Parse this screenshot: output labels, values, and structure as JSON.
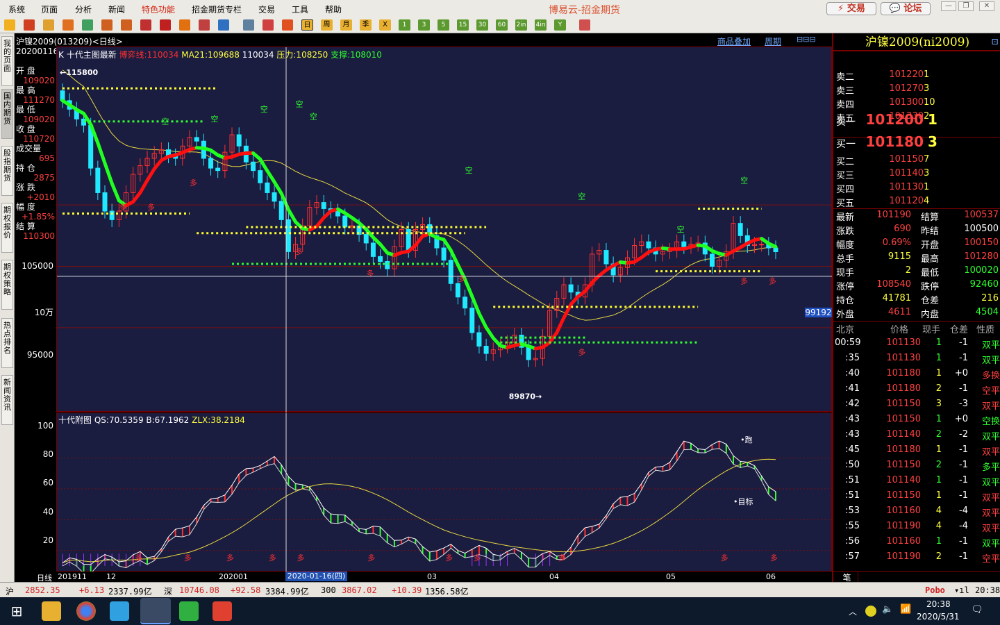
{
  "app": {
    "title": "博易云-招金期货"
  },
  "menu": [
    "系统",
    "页面",
    "分析",
    "新闻",
    "特色功能",
    "招金期货专栏",
    "交易",
    "工具",
    "帮助"
  ],
  "top_buttons": {
    "trade": "交易",
    "forum": "论坛"
  },
  "toolbar": {
    "period_labels": [
      "日",
      "周",
      "月",
      "季",
      "X",
      "1",
      "3",
      "5",
      "15",
      "30",
      "60",
      "2in",
      "4in",
      "Y"
    ]
  },
  "left_tabs": [
    "我的页面",
    "国内期货",
    "股指期货",
    "期权报价",
    "期权策略",
    "热点排名",
    "新闻资讯"
  ],
  "chart": {
    "title": "沪镍2009(013209)<日线>",
    "header_links": [
      "商品叠加",
      "周期"
    ],
    "main_legend": {
      "k": "K",
      "name": "十代主图最新",
      "bo": "博弈线:110034",
      "ma": "MA21:109688",
      "v3": "110034",
      "press": "压力:108250",
      "support": "支撑:108010"
    },
    "sub_legend": {
      "name": "十代附图",
      "qs": "QS:70.5359",
      "b": "B:67.1962",
      "zlx": "ZLX:38.2184"
    },
    "info_col": [
      {
        "label": "20200116",
        "value": ""
      },
      {
        "label": "开 盘",
        "value": "109020"
      },
      {
        "label": "最 高",
        "value": "111270"
      },
      {
        "label": "最 低",
        "value": "109020"
      },
      {
        "label": "收 盘",
        "value": "110720"
      },
      {
        "label": "成交量",
        "value": "695"
      },
      {
        "label": "持 仓",
        "value": "2875"
      },
      {
        "label": "涨 跌",
        "value": "+2010"
      },
      {
        "label": "幅 度",
        "value": "+1.85%"
      },
      {
        "label": "结 算",
        "value": "110300"
      }
    ],
    "main_yaxis": [
      "105000",
      "10万",
      "95000"
    ],
    "sub_yaxis": [
      "100",
      "80",
      "60",
      "40",
      "20"
    ],
    "annotations": {
      "high": "←115800",
      "low": "89870→",
      "pao": "•跑",
      "target": "•目标",
      "kong": "空",
      "duo": "多"
    },
    "price_tag": "99192",
    "xaxis": {
      "period": "日线",
      "labels": [
        "201911",
        "12",
        "202001",
        "03",
        "04",
        "05",
        "06"
      ],
      "cursor_date": "2020-01-16(四)"
    },
    "colors": {
      "up": "#ff3030",
      "down": "#20e8ff",
      "trend_up": "#ff1010",
      "trend_down": "#20ff20",
      "ma": "#e8d840",
      "resist": "#ffff30",
      "support": "#30ff30"
    }
  },
  "chart_data": {
    "type": "candlestick",
    "title": "沪镍2009(013209)<日线>",
    "x_range": [
      "2019-11",
      "2020-06"
    ],
    "ylim": [
      89000,
      117000
    ],
    "marked_high": 115800,
    "marked_low": 89870,
    "close_approx": [
      113500,
      112800,
      112000,
      111500,
      108000,
      106000,
      104500,
      103800,
      104500,
      106000,
      107500,
      108200,
      108800,
      109200,
      109500,
      109000,
      108800,
      109800,
      110500,
      110200,
      108800,
      108000,
      107800,
      109300,
      110720,
      109800,
      108500,
      107800,
      106800,
      106000,
      105300,
      103800,
      101200,
      101800,
      103300,
      104800,
      105200,
      104700,
      104500,
      104100,
      103200,
      103300,
      102600,
      101900,
      100800,
      100400,
      99800,
      101600,
      103000,
      101300,
      103000,
      103400,
      102500,
      101500,
      100500,
      98600,
      97500,
      96600,
      94600,
      93500,
      92900,
      93200,
      93500,
      93800,
      94400,
      93400,
      92400,
      92500,
      94300,
      96400,
      97400,
      98500,
      97900,
      97500,
      98500,
      101000,
      101300,
      100200,
      99300,
      99900,
      100700,
      101700,
      102000,
      101500,
      101000,
      101200,
      101300,
      102000,
      101600,
      101800,
      101900,
      101000,
      100000,
      100500,
      101200,
      103500,
      102500,
      101700,
      101800,
      101800,
      101500,
      101190
    ],
    "indicators": {
      "QS": 70.5359,
      "B": 67.1962,
      "ZLX": 38.2184
    }
  },
  "quote": {
    "title": "沪镍2009(ni2009)",
    "asks": [
      {
        "label": "卖五",
        "price": "101330",
        "vol": "2"
      },
      {
        "label": "卖四",
        "price": "101300",
        "vol": "10"
      },
      {
        "label": "卖三",
        "price": "101270",
        "vol": "3"
      },
      {
        "label": "卖二",
        "price": "101220",
        "vol": "1"
      },
      {
        "label": "卖一",
        "price": "101200",
        "vol": "1"
      }
    ],
    "bids": [
      {
        "label": "买一",
        "price": "101180",
        "vol": "3"
      },
      {
        "label": "买二",
        "price": "101150",
        "vol": "7"
      },
      {
        "label": "买三",
        "price": "101140",
        "vol": "3"
      },
      {
        "label": "买四",
        "price": "101130",
        "vol": "1"
      },
      {
        "label": "买五",
        "price": "101120",
        "vol": "4"
      }
    ],
    "stats": [
      {
        "l1": "最新",
        "v1": "101190",
        "c1": "#ff4040",
        "l2": "结算",
        "v2": "100537",
        "c2": "#ff4040"
      },
      {
        "l1": "涨跌",
        "v1": "690",
        "c1": "#ff4040",
        "l2": "昨结",
        "v2": "100500",
        "c2": "#ffffff"
      },
      {
        "l1": "幅度",
        "v1": "0.69%",
        "c1": "#ff4040",
        "l2": "开盘",
        "v2": "100150",
        "c2": "#ff4040"
      },
      {
        "l1": "总手",
        "v1": "9115",
        "c1": "#ffff40",
        "l2": "最高",
        "v2": "101280",
        "c2": "#ff4040"
      },
      {
        "l1": "现手",
        "v1": "2",
        "c1": "#ffff40",
        "l2": "最低",
        "v2": "100020",
        "c2": "#30ff30"
      },
      {
        "l1": "涨停",
        "v1": "108540",
        "c1": "#ff4040",
        "l2": "跌停",
        "v2": "92460",
        "c2": "#30ff30"
      },
      {
        "l1": "持仓",
        "v1": "41781",
        "c1": "#ffff40",
        "l2": "仓差",
        "v2": "216",
        "c2": "#ffff40"
      },
      {
        "l1": "外盘",
        "v1": "4611",
        "c1": "#ff4040",
        "l2": "内盘",
        "v2": "4504",
        "c2": "#30ff30"
      }
    ],
    "tick_header": [
      "北京",
      "价格",
      "现手",
      "仓差",
      "性质"
    ],
    "ticks": [
      {
        "t": "00:59",
        "p": "101130",
        "v": "1",
        "o": "-1",
        "n": "双平",
        "nc": "#30ff30"
      },
      {
        "t": ":35",
        "p": "101130",
        "v": "1",
        "o": "-1",
        "n": "双平",
        "nc": "#30ff30"
      },
      {
        "t": ":40",
        "p": "101180",
        "v": "1",
        "o": "+0",
        "n": "多换",
        "nc": "#ff4040"
      },
      {
        "t": ":41",
        "p": "101180",
        "v": "2",
        "o": "-1",
        "n": "空平",
        "nc": "#ff4040"
      },
      {
        "t": ":42",
        "p": "101150",
        "v": "3",
        "o": "-3",
        "n": "双平",
        "nc": "#ff4040"
      },
      {
        "t": ":43",
        "p": "101150",
        "v": "1",
        "o": "+0",
        "n": "空换",
        "nc": "#30ff30"
      },
      {
        "t": ":43",
        "p": "101140",
        "v": "2",
        "o": "-2",
        "n": "双平",
        "nc": "#30ff30"
      },
      {
        "t": ":45",
        "p": "101180",
        "v": "1",
        "o": "-1",
        "n": "双平",
        "nc": "#ff4040"
      },
      {
        "t": ":50",
        "p": "101150",
        "v": "2",
        "o": "-1",
        "n": "多平",
        "nc": "#30ff30"
      },
      {
        "t": ":51",
        "p": "101140",
        "v": "1",
        "o": "-1",
        "n": "双平",
        "nc": "#30ff30"
      },
      {
        "t": ":51",
        "p": "101150",
        "v": "1",
        "o": "-1",
        "n": "双平",
        "nc": "#ff4040"
      },
      {
        "t": ":53",
        "p": "101160",
        "v": "4",
        "o": "-4",
        "n": "双平",
        "nc": "#ff4040"
      },
      {
        "t": ":55",
        "p": "101190",
        "v": "4",
        "o": "-4",
        "n": "双平",
        "nc": "#ff4040"
      },
      {
        "t": ":56",
        "p": "101160",
        "v": "1",
        "o": "-1",
        "n": "双平",
        "nc": "#30ff30"
      },
      {
        "t": ":57",
        "p": "101190",
        "v": "2",
        "o": "-1",
        "n": "空平",
        "nc": "#ff4040"
      }
    ],
    "footer_tab": "笔"
  },
  "statusbar": {
    "sh_label": "沪",
    "sh_price": "2852.35",
    "sh_chg": "+6.13",
    "sh_amt": "2337.99亿",
    "sz_label": "深",
    "sz_price": "10746.08",
    "sz_chg": "+92.58",
    "sz_amt": "3384.99亿",
    "i300_label": "300",
    "i300_price": "3867.02",
    "i300_chg": "+10.39",
    "i300_amt": "1356.58亿",
    "brand": "Pobo",
    "time": "20:38"
  },
  "taskbar": {
    "time": "20:38",
    "date": "2020/5/31"
  }
}
